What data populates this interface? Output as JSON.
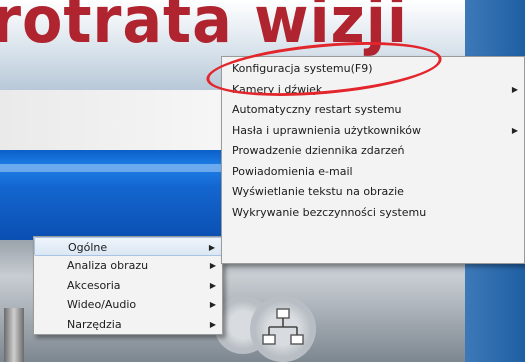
{
  "background": {
    "banner_title": "rotrata wizji"
  },
  "main_menu": {
    "items": [
      {
        "label": "Ogólne",
        "has_submenu": true,
        "selected": true
      },
      {
        "label": "Analiza obrazu",
        "has_submenu": true
      },
      {
        "label": "Akcesoria",
        "has_submenu": true
      },
      {
        "label": "Wideo/Audio",
        "has_submenu": true
      },
      {
        "label": "Narzędzia",
        "has_submenu": true
      }
    ]
  },
  "sub_menu": {
    "items": [
      {
        "label": "Konfiguracja systemu(F9)",
        "has_submenu": false,
        "highlighted": true
      },
      {
        "label": "Kamery i dźwięk",
        "has_submenu": true
      },
      {
        "label": "Automatyczny restart systemu",
        "has_submenu": false
      },
      {
        "label": "Hasła i uprawnienia użytkowników",
        "has_submenu": true
      },
      {
        "label": "Prowadzenie dziennika zdarzeń",
        "has_submenu": false
      },
      {
        "label": "Powiadomienia e-mail",
        "has_submenu": false
      },
      {
        "label": "Wyświetlanie tekstu na obrazie",
        "has_submenu": false
      },
      {
        "label": "Wykrywanie bezczynności systemu",
        "has_submenu": false
      }
    ]
  },
  "icons": {
    "submenu_arrow": "chevron-right-icon",
    "network": "network-icon",
    "tools": "tools-icon"
  },
  "colors": {
    "highlight_circle": "#e3262c",
    "title_red": "#b0242f",
    "band_blue": "#1467d0"
  }
}
